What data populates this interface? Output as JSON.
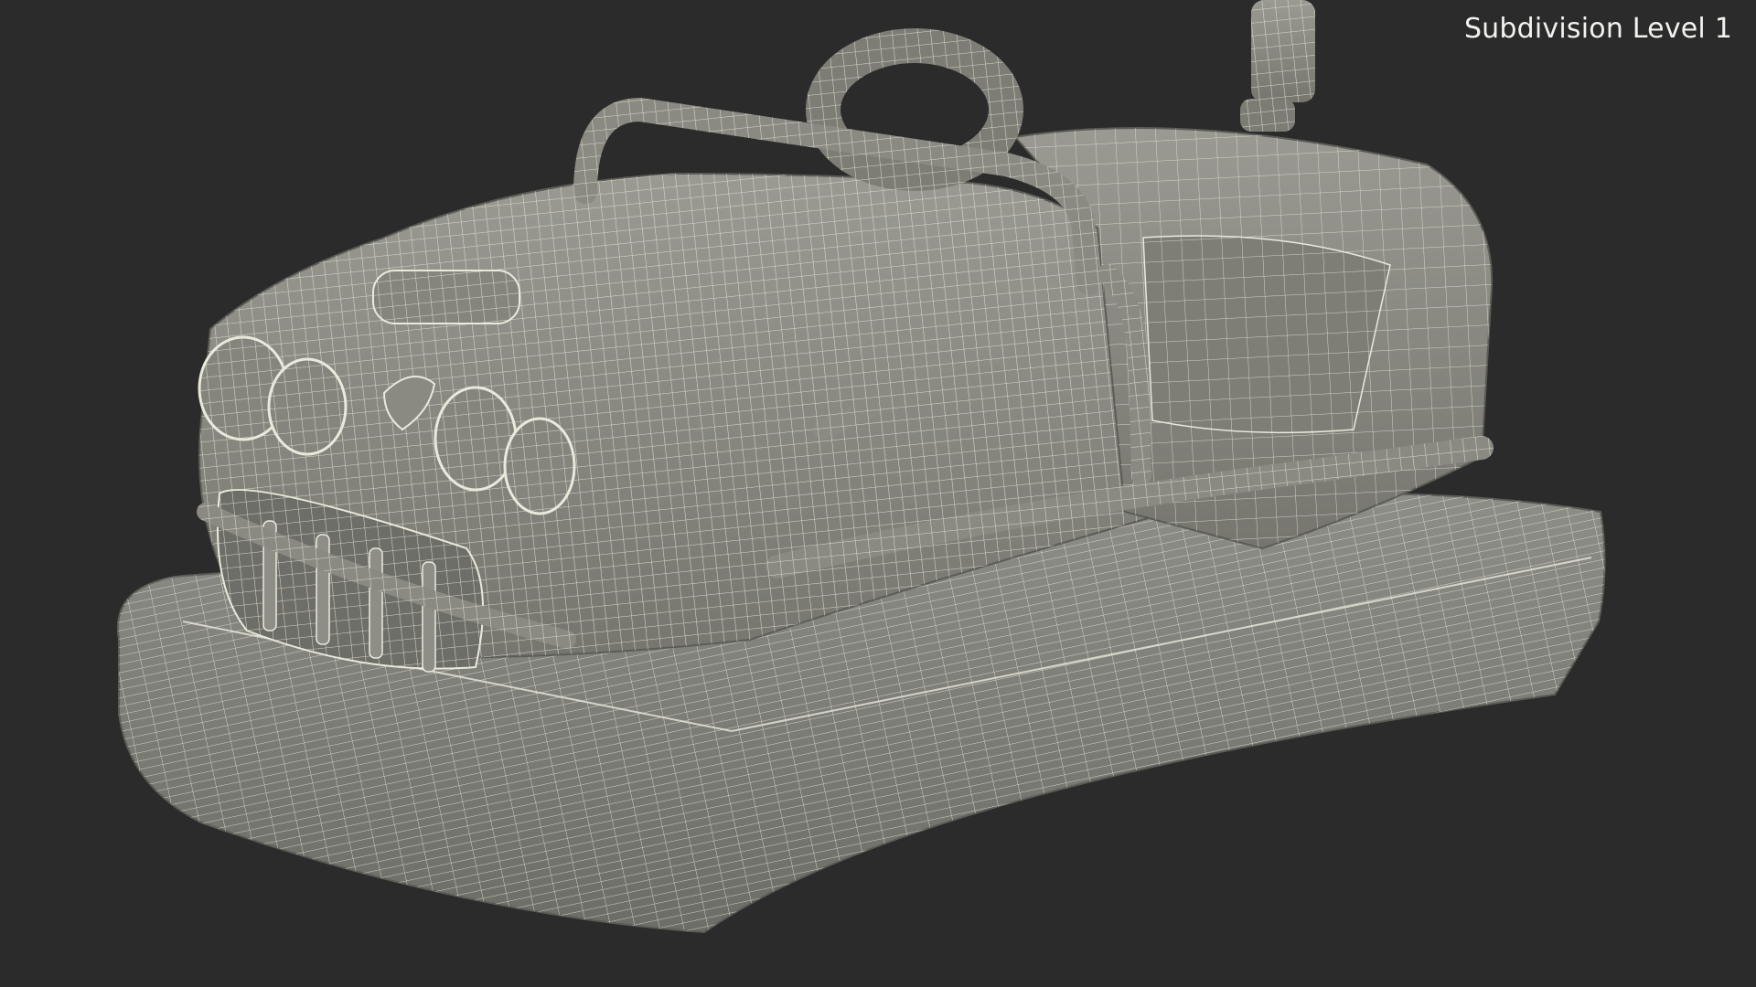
{
  "viewport": {
    "caption": "Subdivision Level 1",
    "background_color": "#2b2b2b",
    "surface_color": "#8c8c86",
    "wire_color": "#e9e9dc"
  }
}
